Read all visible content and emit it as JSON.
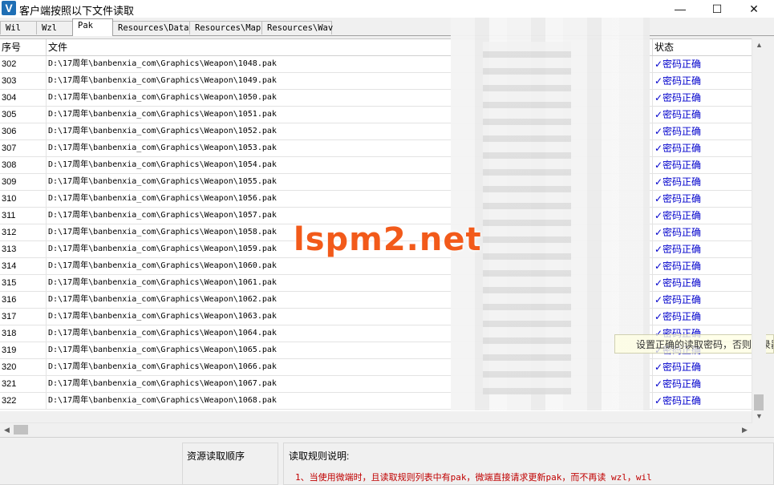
{
  "window": {
    "title": "客户端按照以下文件读取",
    "logo": "V",
    "minimize": "—",
    "maximize": "☐",
    "close": "✕"
  },
  "tabs": [
    {
      "label": "Wil",
      "active": false
    },
    {
      "label": "Wzl",
      "active": false
    },
    {
      "label": "Pak",
      "active": true
    },
    {
      "label": "Resources\\Data",
      "active": false
    },
    {
      "label": "Resources\\Map",
      "active": false
    },
    {
      "label": "Resources\\Wav",
      "active": false
    }
  ],
  "table": {
    "headers": {
      "index": "序号",
      "file": "文件",
      "status": "状态"
    },
    "rows": [
      {
        "index": "302",
        "file": "D:\\17周年\\banbenxia_com\\Graphics\\Weapon\\1048.pak",
        "status": "✓密码正确"
      },
      {
        "index": "303",
        "file": "D:\\17周年\\banbenxia_com\\Graphics\\Weapon\\1049.pak",
        "status": "✓密码正确"
      },
      {
        "index": "304",
        "file": "D:\\17周年\\banbenxia_com\\Graphics\\Weapon\\1050.pak",
        "status": "✓密码正确"
      },
      {
        "index": "305",
        "file": "D:\\17周年\\banbenxia_com\\Graphics\\Weapon\\1051.pak",
        "status": "✓密码正确"
      },
      {
        "index": "306",
        "file": "D:\\17周年\\banbenxia_com\\Graphics\\Weapon\\1052.pak",
        "status": "✓密码正确"
      },
      {
        "index": "307",
        "file": "D:\\17周年\\banbenxia_com\\Graphics\\Weapon\\1053.pak",
        "status": "✓密码正确"
      },
      {
        "index": "308",
        "file": "D:\\17周年\\banbenxia_com\\Graphics\\Weapon\\1054.pak",
        "status": "✓密码正确"
      },
      {
        "index": "309",
        "file": "D:\\17周年\\banbenxia_com\\Graphics\\Weapon\\1055.pak",
        "status": "✓密码正确"
      },
      {
        "index": "310",
        "file": "D:\\17周年\\banbenxia_com\\Graphics\\Weapon\\1056.pak",
        "status": "✓密码正确"
      },
      {
        "index": "311",
        "file": "D:\\17周年\\banbenxia_com\\Graphics\\Weapon\\1057.pak",
        "status": "✓密码正确"
      },
      {
        "index": "312",
        "file": "D:\\17周年\\banbenxia_com\\Graphics\\Weapon\\1058.pak",
        "status": "✓密码正确"
      },
      {
        "index": "313",
        "file": "D:\\17周年\\banbenxia_com\\Graphics\\Weapon\\1059.pak",
        "status": "✓密码正确"
      },
      {
        "index": "314",
        "file": "D:\\17周年\\banbenxia_com\\Graphics\\Weapon\\1060.pak",
        "status": "✓密码正确"
      },
      {
        "index": "315",
        "file": "D:\\17周年\\banbenxia_com\\Graphics\\Weapon\\1061.pak",
        "status": "✓密码正确"
      },
      {
        "index": "316",
        "file": "D:\\17周年\\banbenxia_com\\Graphics\\Weapon\\1062.pak",
        "status": "✓密码正确"
      },
      {
        "index": "317",
        "file": "D:\\17周年\\banbenxia_com\\Graphics\\Weapon\\1063.pak",
        "status": "✓密码正确"
      },
      {
        "index": "318",
        "file": "D:\\17周年\\banbenxia_com\\Graphics\\Weapon\\1064.pak",
        "status": "✓密码正确"
      },
      {
        "index": "319",
        "file": "D:\\17周年\\banbenxia_com\\Graphics\\Weapon\\1065.pak",
        "status": "✓密码正确"
      },
      {
        "index": "320",
        "file": "D:\\17周年\\banbenxia_com\\Graphics\\Weapon\\1066.pak",
        "status": "✓密码正确"
      },
      {
        "index": "321",
        "file": "D:\\17周年\\banbenxia_com\\Graphics\\Weapon\\1067.pak",
        "status": "✓密码正确"
      },
      {
        "index": "322",
        "file": "D:\\17周年\\banbenxia_com\\Graphics\\Weapon\\1068.pak",
        "status": "✓密码正确"
      }
    ]
  },
  "tooltip": "设置正确的读取密码，否则登录器",
  "watermark": "lspm2.net",
  "scroll": {
    "up": "▲",
    "down": "▼",
    "left": "◀",
    "right": "▶"
  },
  "bottom": {
    "order_label": "资源读取顺序",
    "rules_label": "读取规则说明:",
    "rule_1": "1、当使用微端时，且读取规则列表中有pak，微端直接请求更新pak，而不再读 wzl，wil"
  },
  "colors": {
    "status_text": "#0000cc",
    "rule_text": "#c00000",
    "watermark": "#f25a1a",
    "logo_bg": "#1f6fb5"
  }
}
